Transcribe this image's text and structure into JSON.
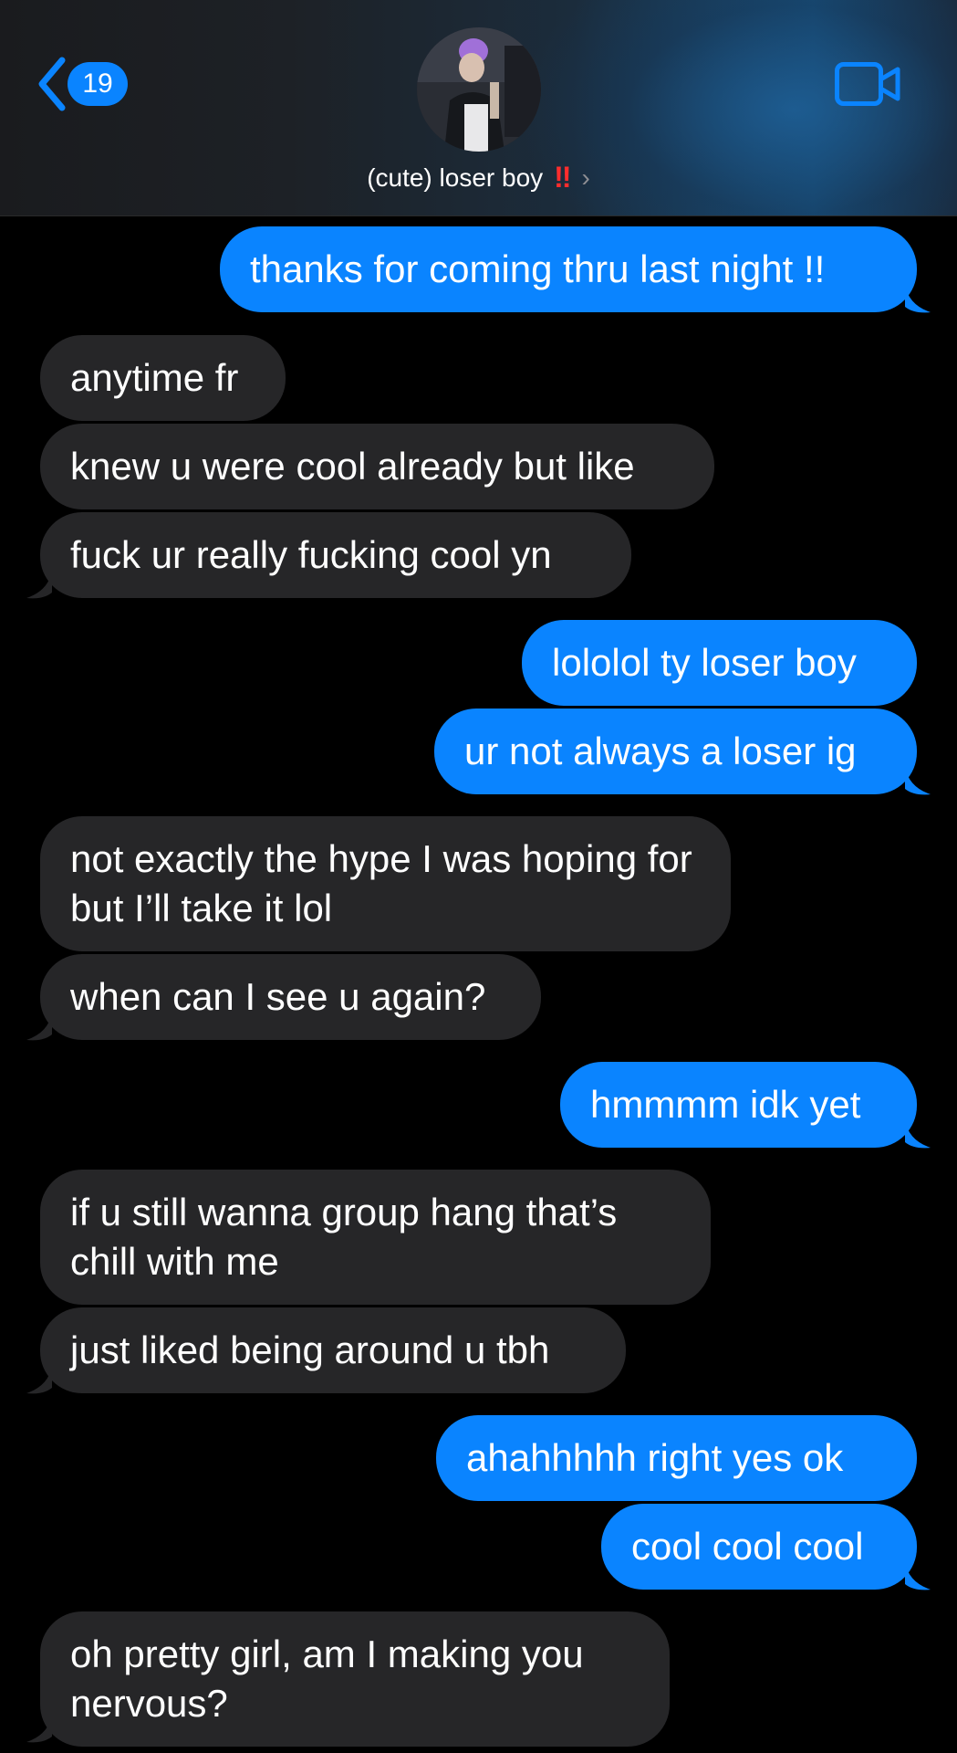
{
  "header": {
    "unread_count": "19",
    "contact_name": "(cute) loser boy",
    "contact_emoji": "‼",
    "chevron": "›",
    "back_icon": "chevron-left-icon",
    "video_icon": "video-camera-icon"
  },
  "colors": {
    "sent_bubble": "#0a84ff",
    "received_bubble": "#262628",
    "background": "#000000"
  },
  "messages": [
    {
      "direction": "sent",
      "text": "thanks for coming thru last night !!"
    },
    {
      "direction": "received",
      "text": "anytime fr"
    },
    {
      "direction": "received",
      "text": "knew u were cool already but like"
    },
    {
      "direction": "received",
      "text": "fuck ur really fucking cool yn"
    },
    {
      "direction": "sent",
      "text": "lololol ty loser boy"
    },
    {
      "direction": "sent",
      "text": "ur not always a loser ig"
    },
    {
      "direction": "received",
      "text": "not exactly the hype I was hoping for but I’ll take it lol"
    },
    {
      "direction": "received",
      "text": "when can I see u again?"
    },
    {
      "direction": "sent",
      "text": "hmmmm idk yet"
    },
    {
      "direction": "received",
      "text": "if u still wanna group hang that’s chill with me"
    },
    {
      "direction": "received",
      "text": "just liked being around u tbh"
    },
    {
      "direction": "sent",
      "text": "ahahhhhh right yes ok"
    },
    {
      "direction": "sent",
      "text": "cool cool cool"
    },
    {
      "direction": "received",
      "text": "oh pretty girl, am I making you nervous?"
    }
  ]
}
